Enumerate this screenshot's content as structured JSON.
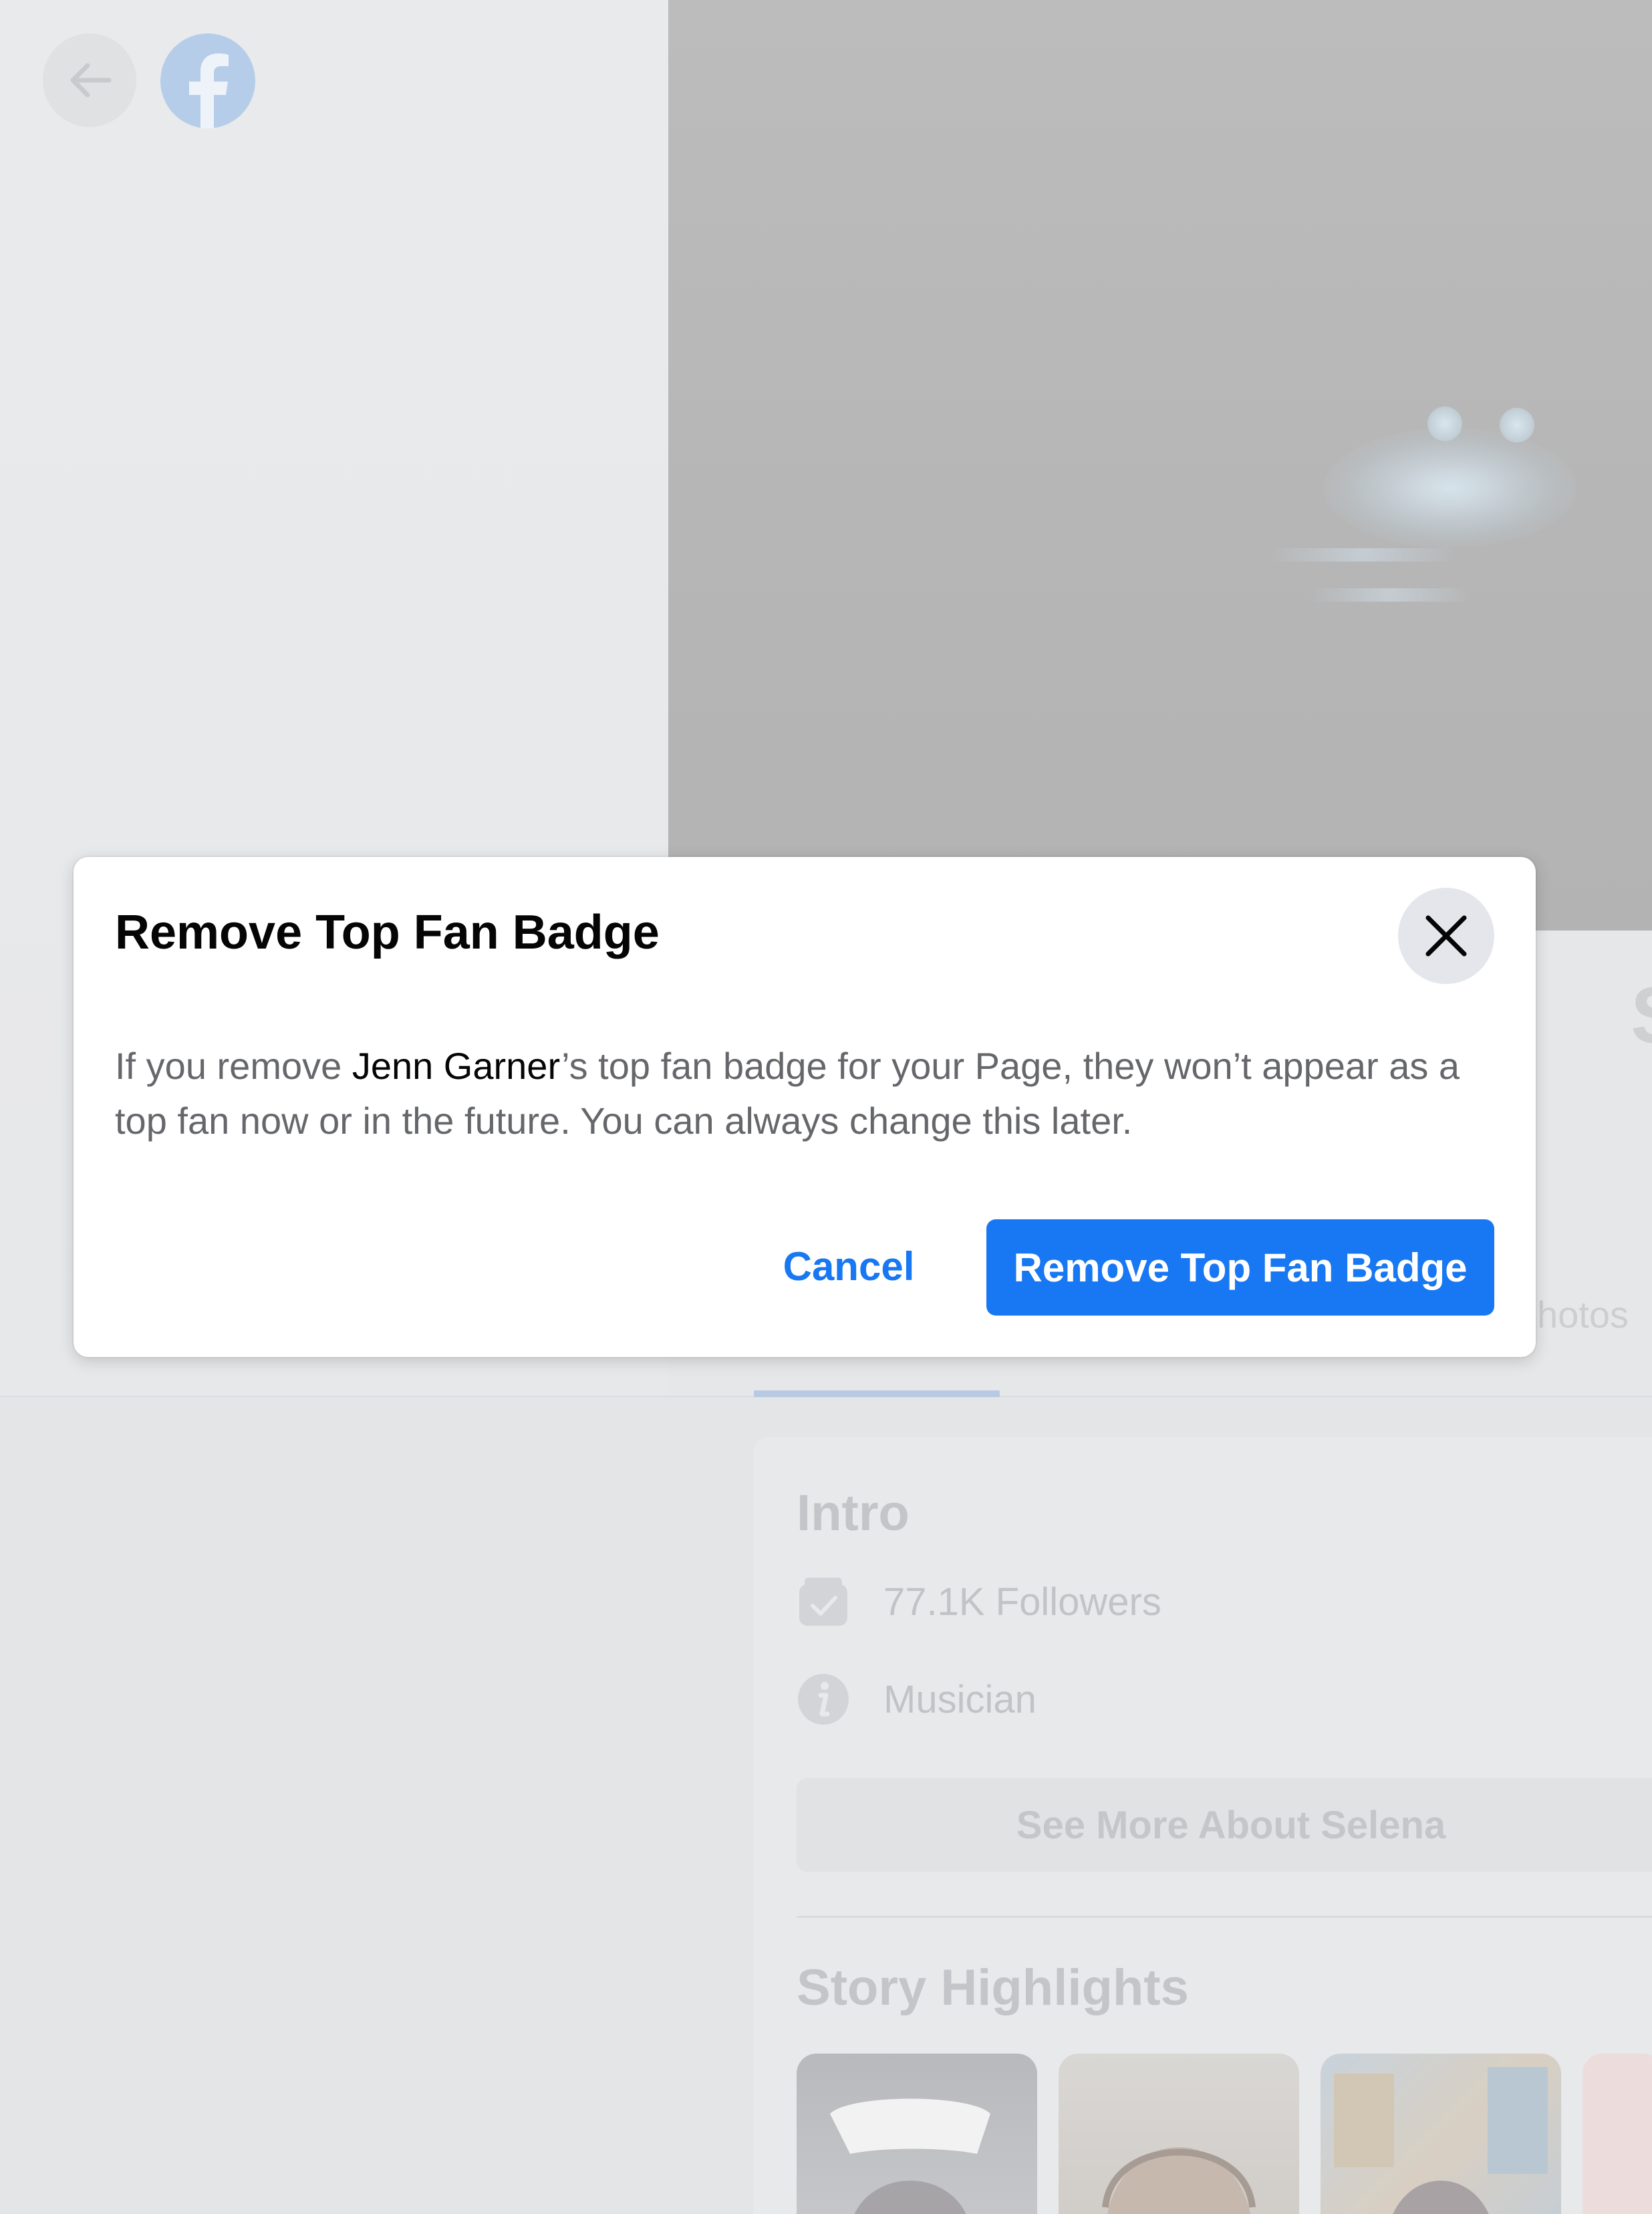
{
  "background": {
    "right_name_glyph": "S",
    "tab_partial_label": "hotos",
    "intro": {
      "title": "Intro",
      "followers": "77.1K Followers",
      "category": "Musician",
      "see_more": "See More About Selena"
    },
    "story_highlights_title": "Story Highlights"
  },
  "dialog": {
    "title": "Remove Top Fan Badge",
    "body_before": "If you remove ",
    "body_name": "Jenn Garner",
    "body_after": "’s top fan badge for your Page, they won’t appear as a top fan now or in the future. You can always change this later.",
    "cancel_label": "Cancel",
    "confirm_label": "Remove Top Fan Badge"
  },
  "colors": {
    "accent": "#1877f2",
    "title_text": "#050505",
    "body_text": "#65676b"
  },
  "icons": {
    "back": "arrow-left-icon",
    "logo": "facebook-logo-icon",
    "close": "close-icon",
    "followers": "followers-icon",
    "info": "info-icon"
  }
}
